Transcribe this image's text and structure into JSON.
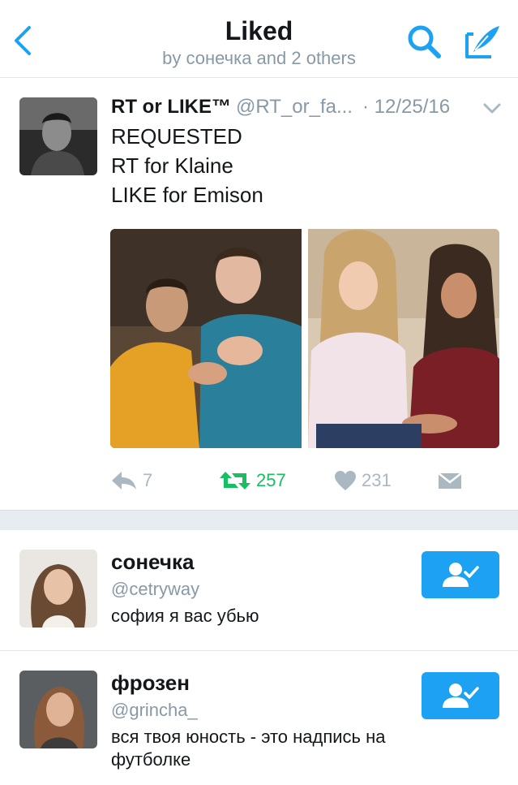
{
  "header": {
    "title": "Liked",
    "subtitle": "by сонечка and 2 others",
    "icons": [
      "back-chevron-icon",
      "search-icon",
      "compose-tweet-icon"
    ],
    "accent": "#1da1f2"
  },
  "tweet": {
    "name": "RT or LIKE™",
    "handle": "@RT_or_fa...",
    "time": "· 12/25/16",
    "lines": [
      "REQUESTED",
      "RT for Klaine",
      "LIKE for Emison"
    ],
    "reply_count": "7",
    "retweet_count": "257",
    "like_count": "231",
    "retweeted": true,
    "retweet_color": "#17bf63"
  },
  "users": [
    {
      "name": "сонечка",
      "handle": "@cetryway",
      "bio": "софия я вас убью",
      "following": true
    },
    {
      "name": "фрозен",
      "handle": "@grincha_",
      "bio": "вся твоя юность - это надпись на футболке",
      "following": true
    }
  ]
}
